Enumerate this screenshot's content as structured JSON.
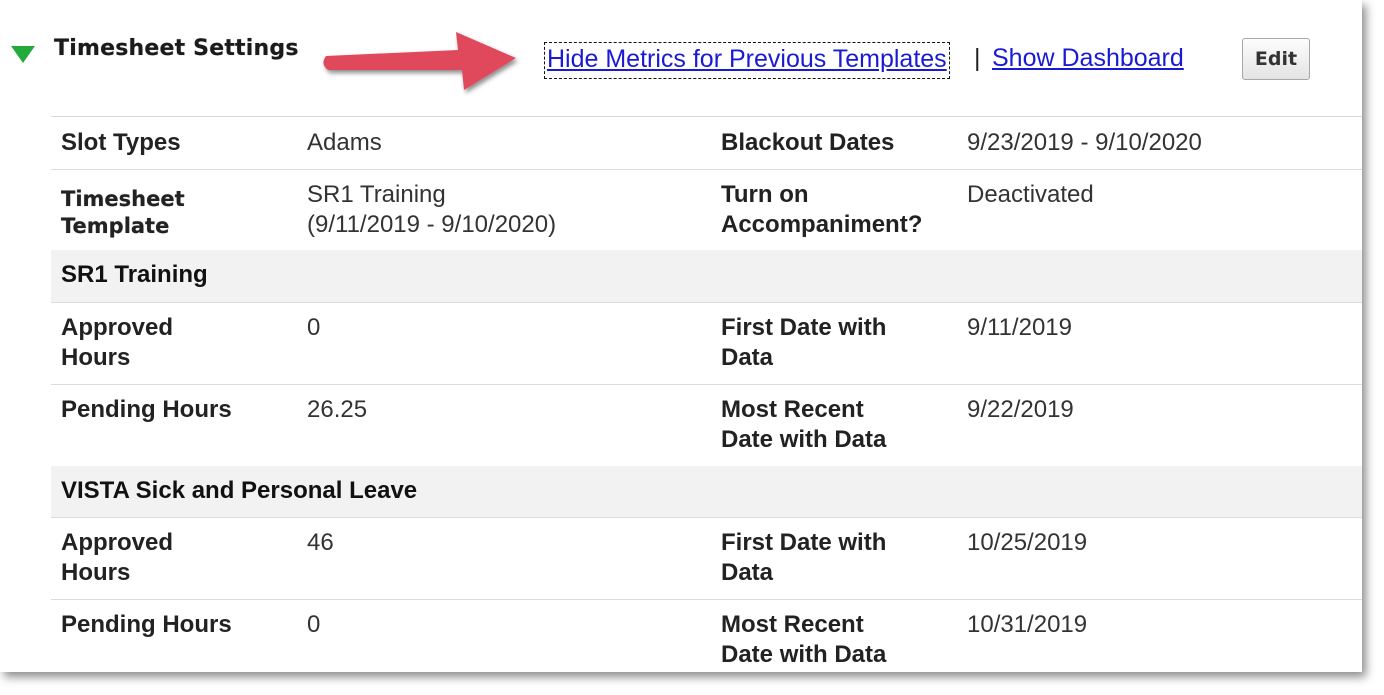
{
  "header": {
    "title": "Timesheet Settings",
    "links": {
      "hide_metrics": "Hide Metrics for Previous Templates",
      "separator": "|",
      "show_dashboard": "Show Dashboard"
    },
    "edit_label": "Edit"
  },
  "colors": {
    "triangle": "#22aa3a",
    "arrow": "#e0485c",
    "link": "#1a1ad6"
  },
  "settings": {
    "slot_types_label": "Slot Types",
    "slot_types_value": "Adams",
    "blackout_label": "Blackout Dates",
    "blackout_value": "9/23/2019 - 9/10/2020",
    "template_label_line1": "Timesheet",
    "template_label_line2": "Template",
    "template_value_line1": "SR1 Training",
    "template_value_line2": "(9/11/2019 - 9/10/2020)",
    "accompaniment_label_line1": "Turn on",
    "accompaniment_label_line2": "Accompaniment?",
    "accompaniment_value": "Deactivated"
  },
  "sections": [
    {
      "title": "SR1 Training",
      "approved_label_line1": "Approved",
      "approved_label_line2": "Hours",
      "approved_value": "0",
      "first_date_label_line1": "First Date with",
      "first_date_label_line2": "Data",
      "first_date_value": "9/11/2019",
      "pending_label": "Pending Hours",
      "pending_value": "26.25",
      "recent_label_line1": "Most Recent",
      "recent_label_line2": "Date with Data",
      "recent_value": "9/22/2019"
    },
    {
      "title": "VISTA Sick and Personal Leave",
      "approved_label_line1": "Approved",
      "approved_label_line2": "Hours",
      "approved_value": "46",
      "first_date_label_line1": "First Date with",
      "first_date_label_line2": "Data",
      "first_date_value": "10/25/2019",
      "pending_label": "Pending Hours",
      "pending_value": "0",
      "recent_label_line1": "Most Recent",
      "recent_label_line2": "Date with Data",
      "recent_value": "10/31/2019"
    }
  ]
}
